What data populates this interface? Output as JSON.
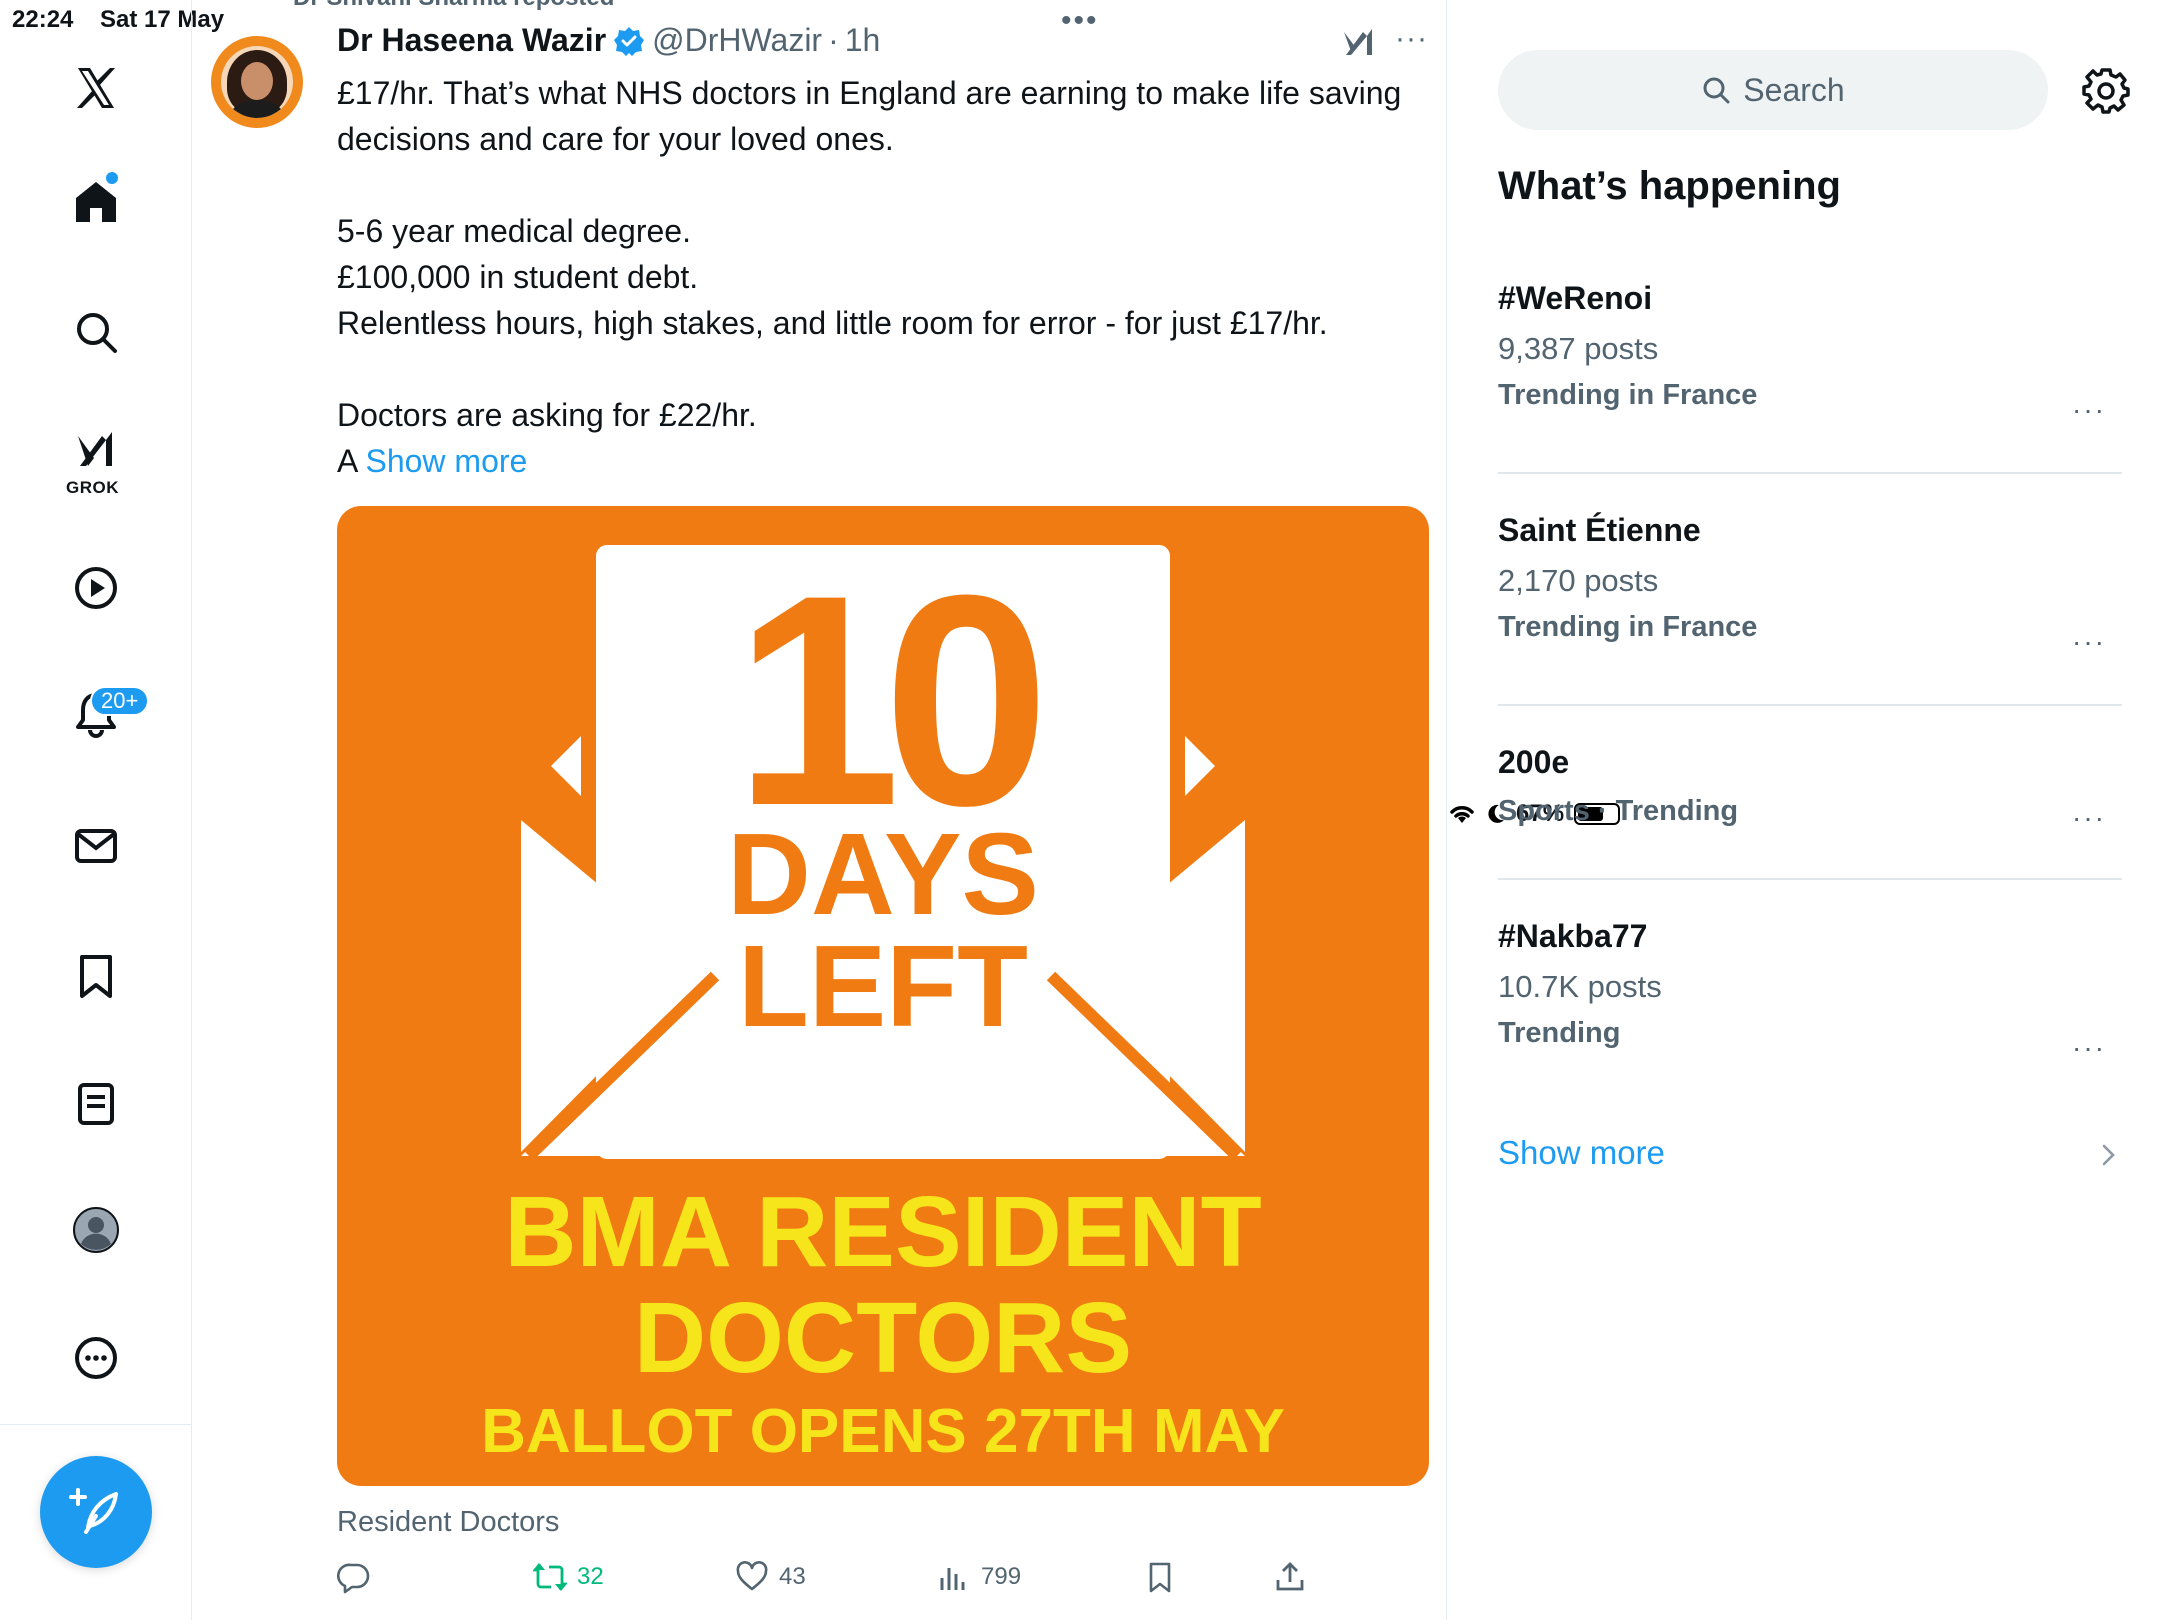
{
  "status_bar": {
    "time": "22:24",
    "date": "Sat 17 May",
    "battery": "67%",
    "battery_level": 0.67
  },
  "nav": {
    "grok_label": "GROK",
    "notifications_badge": "20+"
  },
  "tweet": {
    "repost_line": "Dr Shivani Sharma reposted",
    "author_name": "Dr Haseena Wazir",
    "handle": "@DrHWazir",
    "separator": "·",
    "time_ago": "1h",
    "text_lines": [
      "£17/hr. That’s what NHS doctors in England are earning to make life saving decisions and care for your loved ones.",
      "5-6 year medical degree.",
      "£100,000 in student debt.",
      "Relentless hours, high stakes, and little room for error - for just £17/hr.",
      "Doctors are asking for £22/hr."
    ],
    "truncated_prefix": "A ",
    "show_more": "Show more",
    "media": {
      "big_number": "10",
      "line1": "DAYS",
      "line2": "LEFT",
      "headline1": "BMA RESIDENT",
      "headline2": "DOCTORS",
      "subline": "BALLOT OPENS 27TH MAY",
      "bg_color": "#f07b12",
      "text_yellow": "#f7e51b"
    },
    "caption": "Resident Doctors",
    "stats": {
      "retweets": "32",
      "likes": "43",
      "views": "799"
    }
  },
  "sidebar": {
    "search_placeholder": "Search",
    "title": "What’s happening",
    "trends": [
      {
        "name": "#WeRenoi",
        "count": "9,387 posts",
        "context": "Trending in France"
      },
      {
        "name": "Saint Étienne",
        "count": "2,170 posts",
        "context": "Trending in France"
      },
      {
        "name": "200e",
        "count": "",
        "context": "Sports · Trending"
      },
      {
        "name": "#Nakba77",
        "count": "10.7K posts",
        "context": "Trending"
      }
    ],
    "show_more": "Show more"
  },
  "colors": {
    "accent": "#1d9bf0",
    "retweet_green": "#00ba7c",
    "secondary_text": "#536471"
  }
}
